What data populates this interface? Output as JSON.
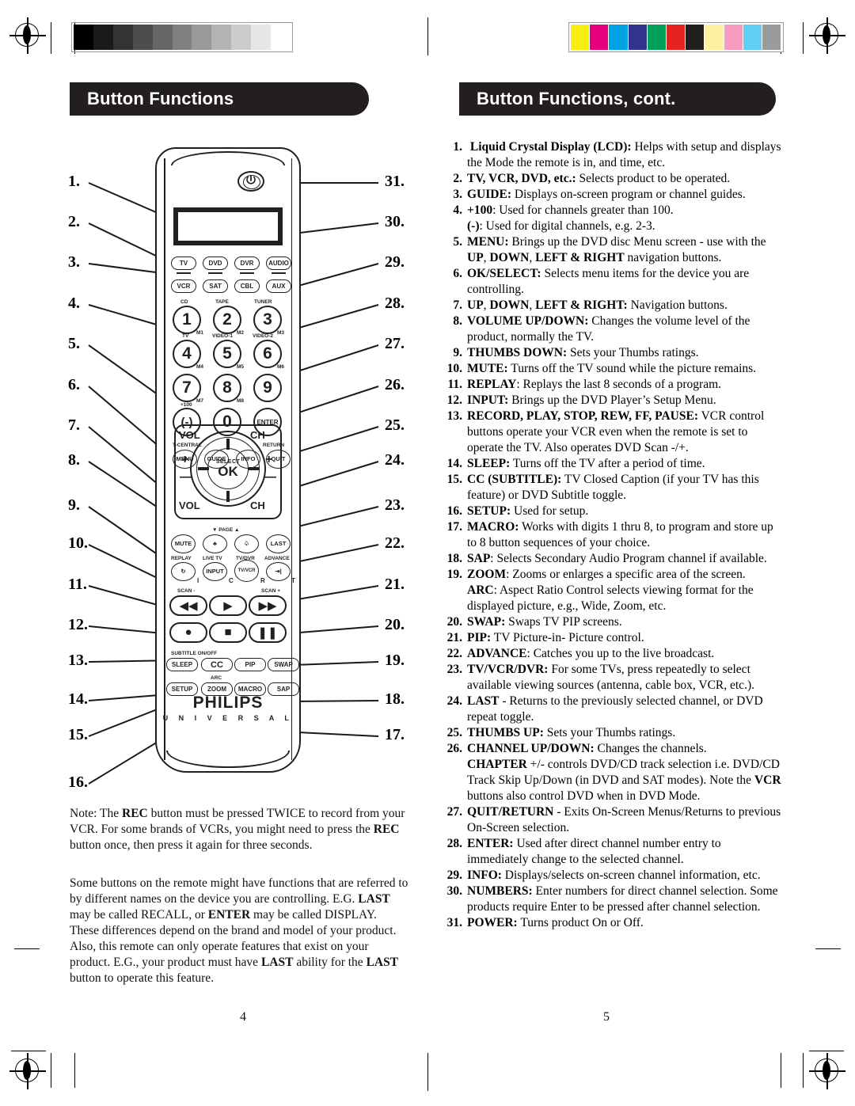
{
  "printmarks": {
    "gray_swatches": [
      "#000000",
      "#1a1a1a",
      "#333333",
      "#4d4d4d",
      "#666666",
      "#808080",
      "#999999",
      "#b3b3b3",
      "#cccccc",
      "#e6e6e6",
      "#ffffff"
    ],
    "color_swatches": [
      "#f7ec13",
      "#e5007e",
      "#00a0e4",
      "#33348e",
      "#00a15a",
      "#e52421",
      "#231f20",
      "#fcf1a0",
      "#f59cc0",
      "#62cef4",
      "#9a9b9c"
    ]
  },
  "left_page": {
    "banner": "Button Functions",
    "page_number": "4",
    "callouts_left": [
      "1.",
      "2.",
      "3.",
      "4.",
      "5.",
      "6.",
      "7.",
      "8.",
      "9.",
      "10.",
      "11.",
      "12.",
      "13.",
      "14.",
      "15.",
      "16."
    ],
    "callouts_right": [
      "31.",
      "30.",
      "29.",
      "28.",
      "27.",
      "26.",
      "25.",
      "24.",
      "23.",
      "22.",
      "21.",
      "20.",
      "19.",
      "18.",
      "17."
    ],
    "remote": {
      "power_icon": "power-icon",
      "device_buttons_row1": [
        "TV",
        "DVD",
        "DVR",
        "AUDIO"
      ],
      "device_buttons_row2": [
        "VCR",
        "SAT",
        "CBL",
        "AUX"
      ],
      "keypad": [
        {
          "digit": "1",
          "top": "CD",
          "bottom": "M1"
        },
        {
          "digit": "2",
          "top": "TAPE",
          "bottom": "M2"
        },
        {
          "digit": "3",
          "top": "TUNER",
          "bottom": "M3"
        },
        {
          "digit": "4",
          "top": "TV",
          "bottom": "M4"
        },
        {
          "digit": "5",
          "top": "VIDEO-1",
          "bottom": "M5"
        },
        {
          "digit": "6",
          "top": "VIDEO-2",
          "bottom": "M6"
        },
        {
          "digit": "7",
          "top": "",
          "bottom": "M7"
        },
        {
          "digit": "8",
          "top": "",
          "bottom": "M8"
        },
        {
          "digit": "9",
          "top": "",
          "bottom": ""
        },
        {
          "digit": "(-)",
          "top": "+100",
          "bottom": ""
        },
        {
          "digit": "0",
          "top": "",
          "bottom": ""
        },
        {
          "digit": "ENTER",
          "top": "",
          "bottom": ""
        }
      ],
      "menu_row": [
        {
          "label": "MENU",
          "cap": "T-CENTRAL"
        },
        {
          "label": "GUIDE",
          "cap": ""
        },
        {
          "label": "INFO",
          "cap": ""
        },
        {
          "label": "QUIT",
          "cap": "RETURN"
        }
      ],
      "nav": {
        "vol_top": "VOL",
        "ch_top": "CH",
        "vol_bottom": "VOL",
        "ch_bottom": "CH",
        "select": "SELECT",
        "ok": "OK",
        "plus": "+",
        "minus_left": "—",
        "minus_right": "—"
      },
      "thumbs_row": [
        {
          "label": "MUTE",
          "cap": ""
        },
        {
          "label": "thumbs-down-icon",
          "cap": ""
        },
        {
          "label": "thumbs-up-icon",
          "cap": ""
        },
        {
          "label": "LAST",
          "cap": ""
        }
      ],
      "page_label": "PAGE",
      "source_row": [
        {
          "label": "replay-icon",
          "cap": "REPLAY",
          "letter": "I"
        },
        {
          "label": "INPUT",
          "cap": "LIVE TV",
          "letter": "C"
        },
        {
          "label": "TV/VCR",
          "cap": "TV/DVR",
          "letter": "R"
        },
        {
          "label": "advance-icon",
          "cap": "ADVANCE",
          "letter": "T"
        }
      ],
      "transport_row1": [
        {
          "icon": "rewind-icon",
          "cap": "SCAN -"
        },
        {
          "icon": "play-icon",
          "cap": ""
        },
        {
          "icon": "fast-forward-icon",
          "cap": "SCAN +"
        }
      ],
      "transport_row2": [
        {
          "icon": "record-icon",
          "cap": ""
        },
        {
          "icon": "stop-icon",
          "cap": ""
        },
        {
          "icon": "pause-icon",
          "cap": ""
        }
      ],
      "bottom_row1": [
        {
          "label": "SLEEP",
          "cap": ""
        },
        {
          "label": "CC",
          "cap": "SUBTITLE ON/OFF"
        },
        {
          "label": "PIP",
          "cap": ""
        },
        {
          "label": "SWAP",
          "cap": ""
        }
      ],
      "bottom_row2": [
        {
          "label": "SETUP",
          "cap": ""
        },
        {
          "label": "ZOOM",
          "cap": "ARC"
        },
        {
          "label": "MACRO",
          "cap": ""
        },
        {
          "label": "SAP",
          "cap": ""
        }
      ],
      "brand_line1": "PHILIPS",
      "brand_line2": "U N I V E R S A L"
    },
    "note_paragraph_html": "Note: The <b>REC</b> button must be pressed TWICE to record from your VCR. For some brands of VCRs, you might need to press the <b>REC</b> button once, then press it again for three seconds.",
    "info_paragraph_html": "Some buttons on the remote might have functions that are referred to by different names on the device you are controlling. E.G. <b>LAST</b> may be called RECALL, or <b>ENTER</b> may be called DISPLAY. These differences depend on the brand and model of your product. Also, this remote can only operate features that exist on your product. E.G., your product must have <b>LAST</b> ability for the <b>LAST</b> button to operate this feature."
  },
  "right_page": {
    "banner": "Button Functions, cont.",
    "page_number": "5",
    "functions": [
      {
        "num": "1.",
        "html": "<b>&nbsp;Liquid Crystal Display (LCD):</b> Helps with setup and displays the Mode the remote is in, and time, etc."
      },
      {
        "num": "2.",
        "html": "<b>TV, VCR, DVD, etc.:</b> Selects product to be operated."
      },
      {
        "num": "3.",
        "html": "<b>GUIDE:</b> Displays on-screen program or channel guides."
      },
      {
        "num": "4.",
        "html": "<b>+100</b>: Used for channels greater than 100.<br><b>(-)</b>: Used for digital channels, e.g. 2-3."
      },
      {
        "num": "5.",
        "html": "<b>MENU:</b> Brings up the DVD disc Menu screen - use with the <b>UP</b>, <b>DOWN</b>, <b>LEFT &amp; RIGHT</b> navigation buttons."
      },
      {
        "num": "6.",
        "html": "<b>OK/SELECT:</b> Selects menu items for the device you are controlling."
      },
      {
        "num": "7.",
        "html": "<b>UP</b>, <b>DOWN</b>, <b>LEFT &amp; RIGHT:</b> Navigation buttons."
      },
      {
        "num": "8.",
        "html": "<b>VOLUME UP/DOWN:</b> Changes the volume level of the product, normally the TV."
      },
      {
        "num": "9.",
        "html": "<b>THUMBS DOWN:</b> Sets your Thumbs ratings."
      },
      {
        "num": "10.",
        "html": "<b>MUTE:</b> Turns off the TV sound while the picture remains."
      },
      {
        "num": "11.",
        "html": "<b>REPLAY</b>: Replays the last 8 seconds of a program."
      },
      {
        "num": "12.",
        "html": "<b>INPUT:</b> Brings up the DVD Player’s Setup Menu."
      },
      {
        "num": "13.",
        "html": "<b>RECORD, PLAY, STOP, REW, FF, PAUSE:</b> VCR control buttons operate your VCR even when the remote is set to operate the TV. Also operates DVD Scan -/+."
      },
      {
        "num": "14.",
        "html": "<b>SLEEP:</b> Turns off the TV after a period of time."
      },
      {
        "num": "15.",
        "html": "<b>CC (SUBTITLE):</b> TV Closed Caption (if your TV has this feature) or DVD Subtitle toggle."
      },
      {
        "num": "16.",
        "html": "<b>SETUP:</b> Used for setup."
      },
      {
        "num": "17.",
        "html": "<b>MACRO:</b> Works with digits 1 thru 8, to program and store up to 8 button sequences of your choice."
      },
      {
        "num": "18.",
        "html": "<b>SAP</b>: Selects Secondary Audio Program channel if available."
      },
      {
        "num": "19.",
        "html": "<b>ZOOM</b>: Zooms or enlarges a specific area of the screen.<br><b>ARC</b>: Aspect Ratio Control selects viewing format for the displayed picture, e.g., Wide, Zoom, etc."
      },
      {
        "num": "20.",
        "html": "<b>SWAP:</b> Swaps TV PIP screens."
      },
      {
        "num": "21.",
        "html": "<b>PIP:</b> TV Picture-in- Picture control."
      },
      {
        "num": "22.",
        "html": "<b>ADVANCE</b>: Catches you up to the live broadcast."
      },
      {
        "num": "23.",
        "html": "<b>TV/VCR/DVR:</b> For some TVs, press repeatedly to select available viewing sources (antenna, cable box, VCR, etc.)."
      },
      {
        "num": "24.",
        "html": "<b>LAST</b> - Returns to the previously selected channel, or DVD repeat toggle."
      },
      {
        "num": "25.",
        "html": "<b>THUMBS UP:</b> Sets your Thumbs ratings."
      },
      {
        "num": "26.",
        "html": "<b>CHANNEL UP/DOWN:</b> Changes the channels.<br><b>CHAPTER</b> +/- controls DVD/CD track selection i.e. DVD/CD Track Skip Up/Down (in DVD and SAT modes). Note the <b>VCR</b> buttons also control DVD when in DVD Mode."
      },
      {
        "num": "27.",
        "html": "<b>QUIT/RETURN</b> - Exits On-Screen Menus/Returns to previous On-Screen selection."
      },
      {
        "num": "28.",
        "html": "<b>ENTER:</b> Used after direct channel number entry to immediately change to the selected channel."
      },
      {
        "num": "29.",
        "html": "<b>INFO:</b> Displays/selects on-screen channel information, etc."
      },
      {
        "num": "30.",
        "html": "<b>NUMBERS:</b> Enter numbers for direct channel selection. Some products require Enter to be pressed after channel selection."
      },
      {
        "num": "31.",
        "html": "<b>POWER:</b> Turns product On or Off."
      }
    ]
  }
}
